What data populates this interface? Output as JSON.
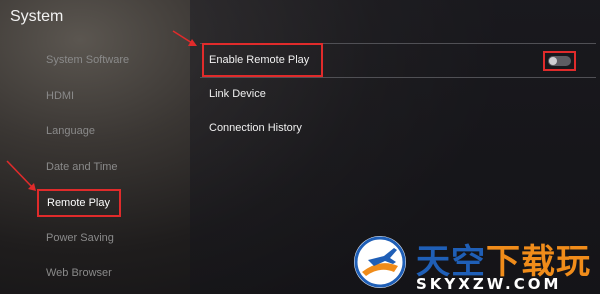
{
  "header": {
    "title": "System"
  },
  "sidebar": {
    "items": [
      {
        "label": "System Software"
      },
      {
        "label": "HDMI"
      },
      {
        "label": "Language"
      },
      {
        "label": "Date and Time"
      },
      {
        "label": "Remote Play",
        "selected": true
      },
      {
        "label": "Power Saving"
      },
      {
        "label": "Web Browser"
      }
    ]
  },
  "main": {
    "rows": [
      {
        "label": "Enable Remote Play",
        "toggle": "off"
      },
      {
        "label": "Link Device"
      },
      {
        "label": "Connection History"
      }
    ]
  },
  "watermark": {
    "cn_part1": "天空",
    "cn_part2": "下载玩",
    "en": "SKYXZW.COM"
  },
  "colors": {
    "annotation_red": "#e02b2b",
    "logo_blue": "#1f5fb7",
    "logo_orange": "#f08c1a"
  },
  "icons": [
    "annotation-arrow-icon",
    "toggle-switch-icon",
    "airplane-logo-icon"
  ]
}
